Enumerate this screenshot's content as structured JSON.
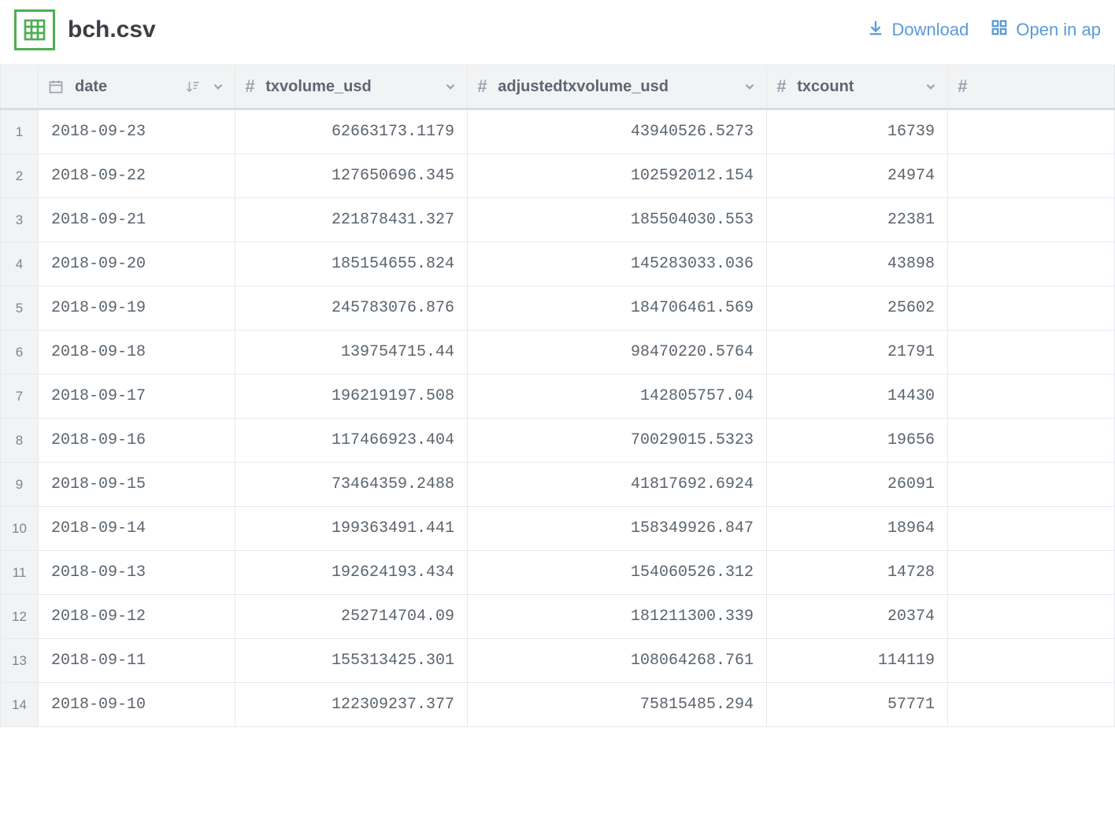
{
  "header": {
    "filename": "bch.csv",
    "download_label": "Download",
    "open_label": "Open in ap"
  },
  "columns": {
    "date": "date",
    "txvolume": "txvolume_usd",
    "adjtxvolume": "adjustedtxvolume_usd",
    "txcount": "txcount"
  },
  "rows": [
    {
      "n": "1",
      "date": "2018-09-23",
      "txvol": "62663173.1179",
      "adj": "43940526.5273",
      "cnt": "16739"
    },
    {
      "n": "2",
      "date": "2018-09-22",
      "txvol": "127650696.345",
      "adj": "102592012.154",
      "cnt": "24974"
    },
    {
      "n": "3",
      "date": "2018-09-21",
      "txvol": "221878431.327",
      "adj": "185504030.553",
      "cnt": "22381"
    },
    {
      "n": "4",
      "date": "2018-09-20",
      "txvol": "185154655.824",
      "adj": "145283033.036",
      "cnt": "43898"
    },
    {
      "n": "5",
      "date": "2018-09-19",
      "txvol": "245783076.876",
      "adj": "184706461.569",
      "cnt": "25602"
    },
    {
      "n": "6",
      "date": "2018-09-18",
      "txvol": "139754715.44",
      "adj": "98470220.5764",
      "cnt": "21791"
    },
    {
      "n": "7",
      "date": "2018-09-17",
      "txvol": "196219197.508",
      "adj": "142805757.04",
      "cnt": "14430"
    },
    {
      "n": "8",
      "date": "2018-09-16",
      "txvol": "117466923.404",
      "adj": "70029015.5323",
      "cnt": "19656"
    },
    {
      "n": "9",
      "date": "2018-09-15",
      "txvol": "73464359.2488",
      "adj": "41817692.6924",
      "cnt": "26091"
    },
    {
      "n": "10",
      "date": "2018-09-14",
      "txvol": "199363491.441",
      "adj": "158349926.847",
      "cnt": "18964"
    },
    {
      "n": "11",
      "date": "2018-09-13",
      "txvol": "192624193.434",
      "adj": "154060526.312",
      "cnt": "14728"
    },
    {
      "n": "12",
      "date": "2018-09-12",
      "txvol": "252714704.09",
      "adj": "181211300.339",
      "cnt": "20374"
    },
    {
      "n": "13",
      "date": "2018-09-11",
      "txvol": "155313425.301",
      "adj": "108064268.761",
      "cnt": "114119"
    },
    {
      "n": "14",
      "date": "2018-09-10",
      "txvol": "122309237.377",
      "adj": "75815485.294",
      "cnt": "57771"
    }
  ]
}
